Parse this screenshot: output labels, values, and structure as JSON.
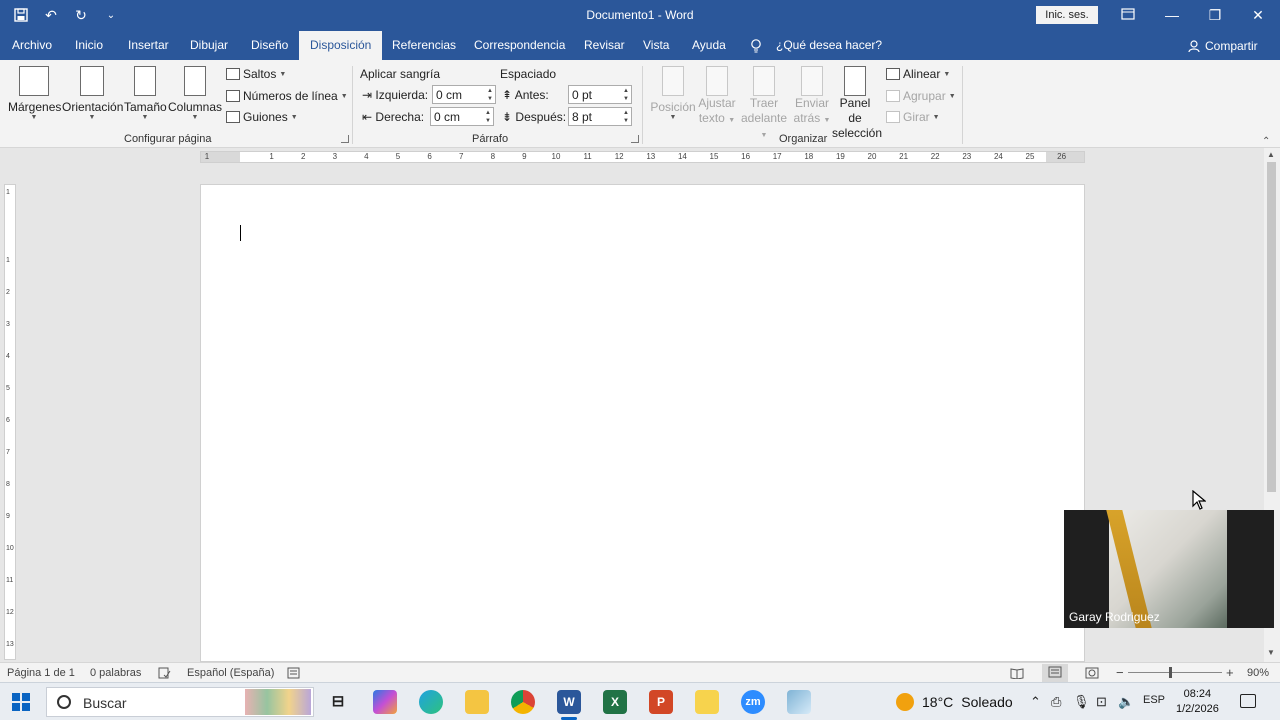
{
  "title_bar": {
    "document_title": "Documento1  -  Word",
    "sign_in": "Inic. ses.",
    "qat_icons": [
      "save-icon",
      "undo-icon",
      "redo-icon",
      "customize-icon"
    ]
  },
  "tabs": [
    {
      "label": "Archivo"
    },
    {
      "label": "Inicio"
    },
    {
      "label": "Insertar"
    },
    {
      "label": "Dibujar"
    },
    {
      "label": "Diseño"
    },
    {
      "label": "Disposición",
      "active": true
    },
    {
      "label": "Referencias"
    },
    {
      "label": "Correspondencia"
    },
    {
      "label": "Revisar"
    },
    {
      "label": "Vista"
    },
    {
      "label": "Ayuda"
    }
  ],
  "tell_me": "¿Qué desea hacer?",
  "share": "Compartir",
  "ribbon": {
    "page_setup": {
      "margins": "Márgenes",
      "orientation": "Orientación",
      "size": "Tamaño",
      "columns": "Columnas",
      "breaks": "Saltos",
      "line_numbers": "Números de línea",
      "hyphenation": "Guiones",
      "group_label": "Configurar página"
    },
    "paragraph": {
      "indent_title": "Aplicar sangría",
      "left_label": "Izquierda:",
      "left_value": "0 cm",
      "right_label": "Derecha:",
      "right_value": "0 cm",
      "spacing_title": "Espaciado",
      "before_label": "Antes:",
      "before_value": "0 pt",
      "after_label": "Después:",
      "after_value": "8 pt",
      "group_label": "Párrafo"
    },
    "arrange": {
      "position": "Posición",
      "wrap_line1": "Ajustar",
      "wrap_line2": "texto",
      "forward_line1": "Traer",
      "forward_line2": "adelante",
      "backward_line1": "Enviar",
      "backward_line2": "atrás",
      "selection_line1": "Panel de",
      "selection_line2": "selección",
      "align": "Alinear",
      "group": "Agrupar",
      "rotate": "Girar",
      "group_label": "Organizar"
    }
  },
  "ruler": {
    "labels": [
      "1",
      "1",
      "2",
      "3",
      "4",
      "5",
      "6",
      "7",
      "8",
      "9",
      "10",
      "11",
      "12",
      "13",
      "14",
      "15",
      "16",
      "17",
      "18",
      "19",
      "20",
      "21",
      "22",
      "23",
      "24",
      "25",
      "26"
    ],
    "vlabels": [
      "1",
      "1",
      "2",
      "3",
      "4",
      "5",
      "6",
      "7",
      "8",
      "9",
      "10",
      "11",
      "12",
      "13"
    ],
    "tab_selector": "L"
  },
  "video": {
    "participant_name": "Garay Rodriguez"
  },
  "status_bar": {
    "page": "Página 1 de 1",
    "words": "0 palabras",
    "language": "Español (España)",
    "zoom": "90%",
    "zoom_minus": "−",
    "zoom_plus": "+"
  },
  "taskbar": {
    "search_label": "Buscar",
    "apps": [
      "task-view-icon",
      "copilot-icon",
      "edge-icon",
      "file-explorer-icon",
      "chrome-icon",
      "word-icon",
      "excel-icon",
      "powerpoint-icon",
      "sticky-icon",
      "zoom-icon",
      "app-icon"
    ],
    "weather_temp": "18°C",
    "weather_desc": "Soleado",
    "lang": "ESP",
    "time": "08:24",
    "date": "1/2/2026",
    "app_labels": {
      "word": "W",
      "excel": "X",
      "powerpoint": "P",
      "zoom": "zm"
    }
  }
}
